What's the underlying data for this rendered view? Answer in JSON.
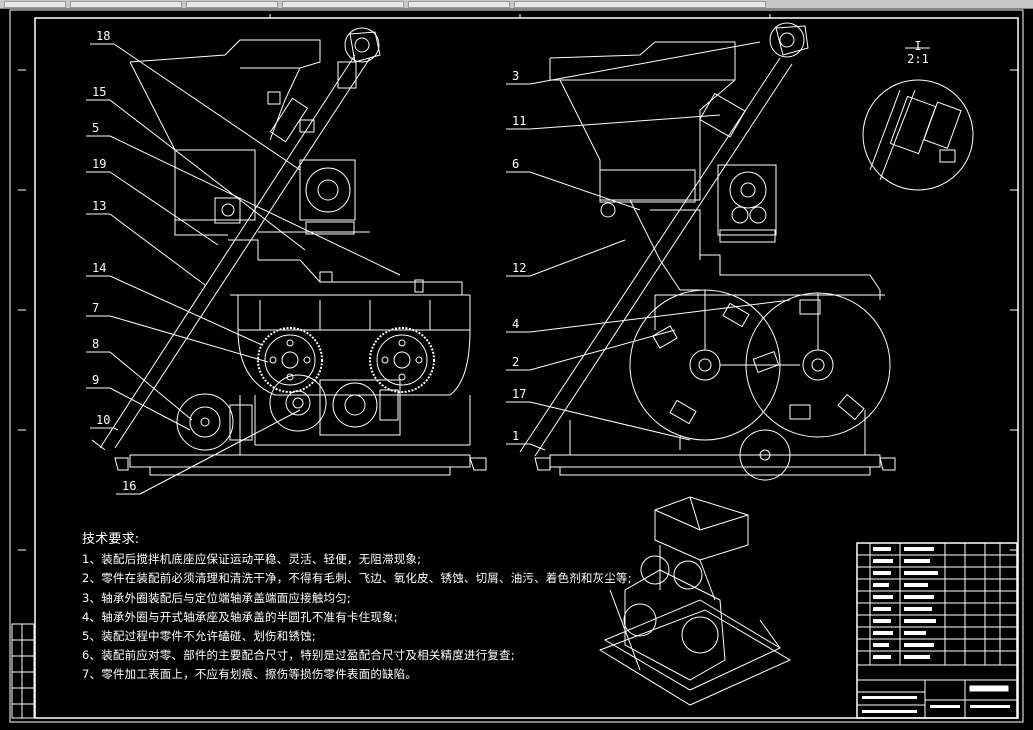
{
  "drawing": {
    "tech_requirements": {
      "title": "技术要求:",
      "items": [
        "1、装配后搅拌机底座应保证运动平稳、灵活、轻便，无阻滞现象;",
        "2、零件在装配前必须清理和清洗干净，不得有毛刺、飞边、氧化皮、锈蚀、切屑、油污、着色剂和灰尘等;",
        "3、轴承外圈装配后与定位端轴承盖端面应接触均匀;",
        "4、轴承外圈与开式轴承座及轴承盖的半圆孔不准有卡住现象;",
        "5、装配过程中零件不允许磕碰、划伤和锈蚀;",
        "6、装配前应对零、部件的主要配合尺寸，特别是过盈配合尺寸及相关精度进行复查;",
        "7、零件加工表面上，不应有划痕、擦伤等损伤零件表面的缺陷。"
      ]
    },
    "left_view_callouts": [
      "18",
      "15",
      "5",
      "19",
      "13",
      "14",
      "7",
      "8",
      "9",
      "10",
      "16"
    ],
    "right_view_callouts": [
      "3",
      "11",
      "6",
      "12",
      "4",
      "2",
      "17",
      "1"
    ],
    "section_label": "I",
    "section_scale": "2:1"
  }
}
